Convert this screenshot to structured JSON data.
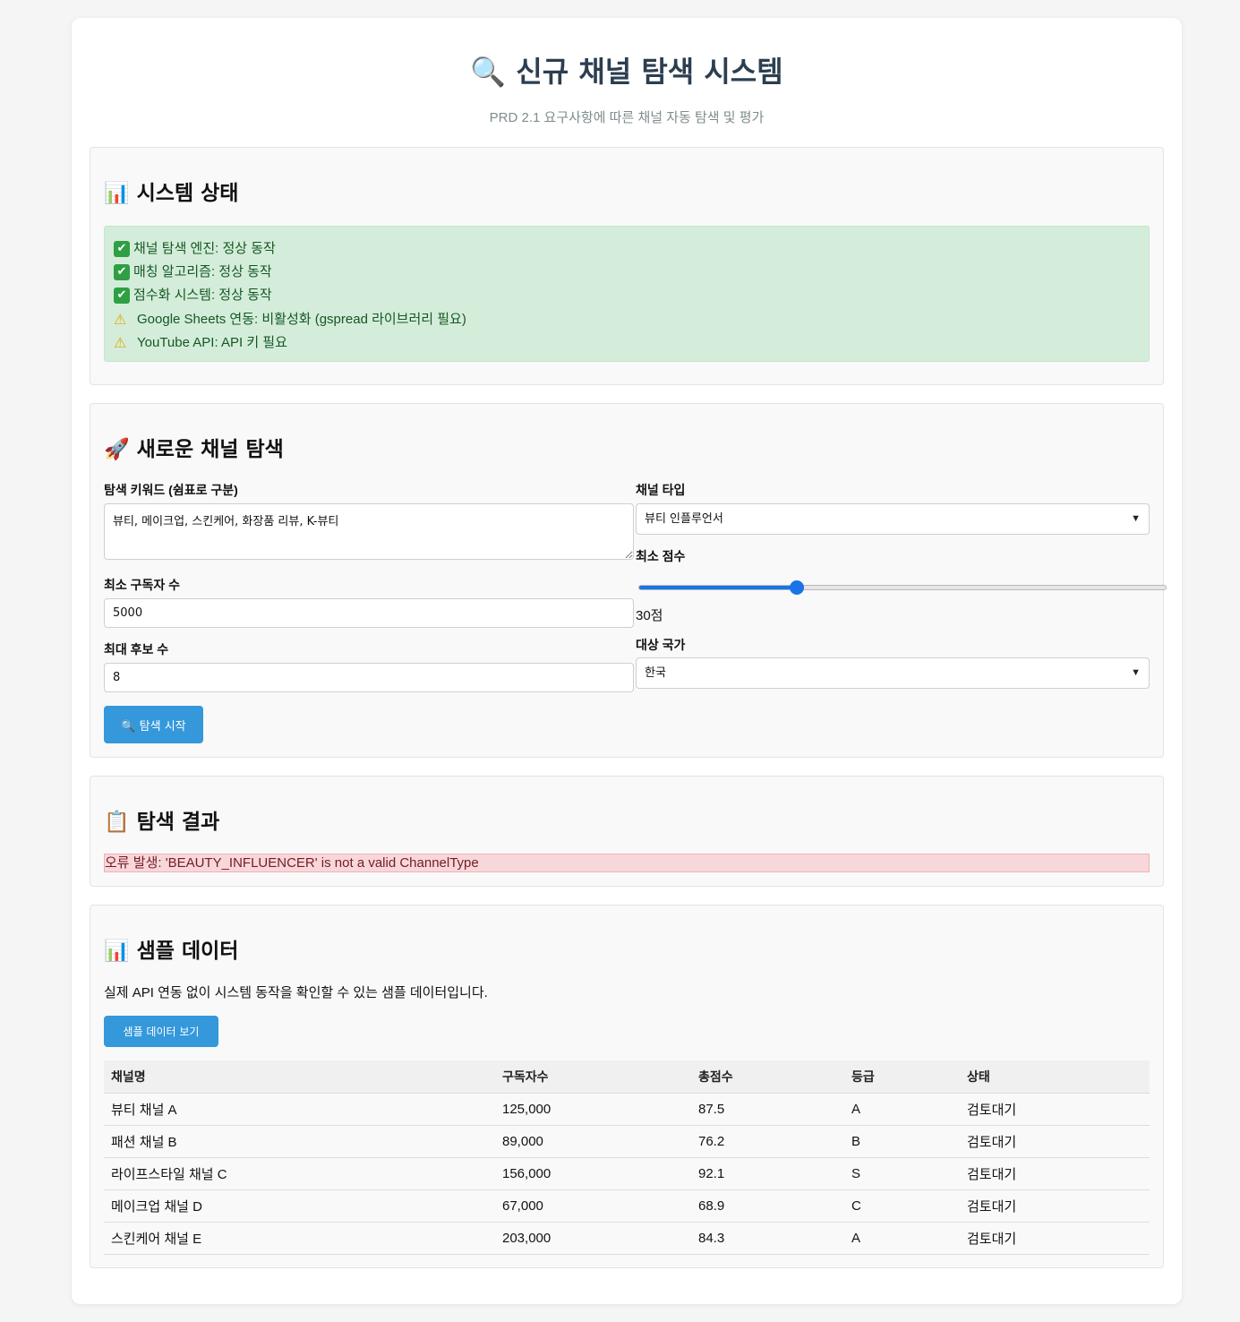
{
  "header": {
    "title_icon": "🔍",
    "title": "신규 채널 탐색 시스템",
    "subtitle": "PRD 2.1 요구사항에 따른 채널 자동 탐색 및 평가"
  },
  "status": {
    "title": "📊 시스템 상태",
    "items": [
      {
        "icon": "check-icon",
        "text": "채널 탐색 엔진: 정상 동작"
      },
      {
        "icon": "check-icon",
        "text": "매칭 알고리즘: 정상 동작"
      },
      {
        "icon": "check-icon",
        "text": "점수화 시스템: 정상 동작"
      },
      {
        "icon": "warning-icon",
        "text": "Google Sheets 연동: 비활성화 (gspread 라이브러리 필요)"
      },
      {
        "icon": "warning-icon",
        "text": "YouTube API: API 키 필요"
      }
    ]
  },
  "search": {
    "title": "🚀 새로운 채널 탐색",
    "keywords_label": "탐색 키워드 (쉼표로 구분)",
    "keywords_value": "뷰티, 메이크업, 스킨케어, 화장품 리뷰, K-뷰티",
    "channel_type_label": "채널 타입",
    "channel_type_value": "뷰티 인플루언서",
    "min_score_label": "최소 점수",
    "min_score_value": 30,
    "min_score_max": 100,
    "min_score_readout": "30점",
    "min_subscribers_label": "최소 구독자 수",
    "min_subscribers_value": "5000",
    "max_candidates_label": "최대 후보 수",
    "max_candidates_value": "8",
    "country_label": "대상 국가",
    "country_value": "한국",
    "start_button": "🔍 탐색 시작"
  },
  "result": {
    "title": "📋 탐색 결과",
    "error": "오류 발생: 'BEAUTY_INFLUENCER' is not a valid ChannelType"
  },
  "sample": {
    "title": "📊 샘플 데이터",
    "description": "실제 API 연동 없이 시스템 동작을 확인할 수 있는 샘플 데이터입니다.",
    "button": "샘플 데이터 보기",
    "columns": [
      "채널명",
      "구독자수",
      "총점수",
      "등급",
      "상태"
    ],
    "rows": [
      [
        "뷰티 채널 A",
        "125,000",
        "87.5",
        "A",
        "검토대기"
      ],
      [
        "패션 채널 B",
        "89,000",
        "76.2",
        "B",
        "검토대기"
      ],
      [
        "라이프스타일 채널 C",
        "156,000",
        "92.1",
        "S",
        "검토대기"
      ],
      [
        "메이크업 채널 D",
        "67,000",
        "68.9",
        "C",
        "검토대기"
      ],
      [
        "스킨케어 채널 E",
        "203,000",
        "84.3",
        "A",
        "검토대기"
      ]
    ]
  },
  "colors": {
    "primary": "#3498db",
    "title": "#2c3e50",
    "success_bg": "#d4edda",
    "error_bg": "#f8d7da"
  }
}
